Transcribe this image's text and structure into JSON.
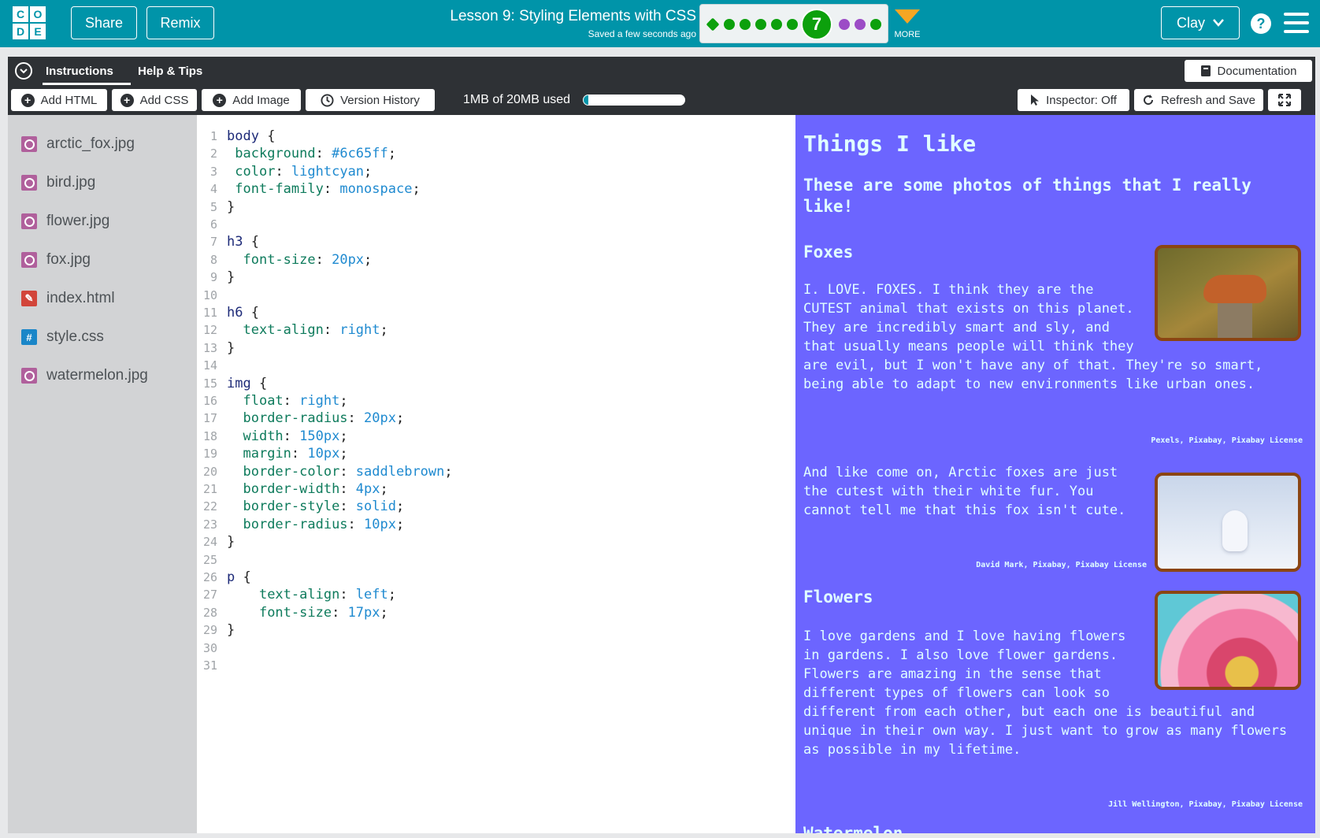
{
  "header": {
    "logo_letters": [
      "C",
      "O",
      "D",
      "E"
    ],
    "share_label": "Share",
    "remix_label": "Remix",
    "lesson_title": "Lesson 9: Styling Elements with CSS",
    "saved_status": "Saved a few seconds ago",
    "current_level": "7",
    "more_label": "MORE",
    "user_name": "Clay",
    "help_glyph": "?"
  },
  "instructions": {
    "tab_instructions": "Instructions",
    "tab_help": "Help & Tips",
    "documentation_label": "Documentation"
  },
  "toolbar": {
    "add_html": "Add HTML",
    "add_css": "Add CSS",
    "add_image": "Add Image",
    "version_history": "Version History",
    "usage_text": "1MB of 20MB used",
    "usage_fraction": 0.05,
    "inspector": "Inspector: Off",
    "refresh_save": "Refresh and Save"
  },
  "files": [
    {
      "name": "arctic_fox.jpg",
      "type": "image"
    },
    {
      "name": "bird.jpg",
      "type": "image"
    },
    {
      "name": "flower.jpg",
      "type": "image"
    },
    {
      "name": "fox.jpg",
      "type": "image"
    },
    {
      "name": "index.html",
      "type": "html"
    },
    {
      "name": "style.css",
      "type": "css"
    },
    {
      "name": "watermelon.jpg",
      "type": "image"
    }
  ],
  "code": [
    "body {",
    " background: #6c65ff;",
    " color: lightcyan;",
    " font-family: monospace;",
    "}",
    "",
    "h3 {",
    "  font-size: 20px;",
    "}",
    "",
    "h6 {",
    "  text-align: right;",
    "}",
    "",
    "img {",
    "  float: right;",
    "  border-radius: 20px;",
    "  width: 150px;",
    "  margin: 10px;",
    "  border-color: saddlebrown;",
    "  border-width: 4px;",
    "  border-style: solid;",
    "  border-radius: 10px;",
    "}",
    "",
    "p {",
    "    text-align: left;",
    "    font-size: 17px;",
    "}",
    "",
    ""
  ],
  "preview": {
    "title": "Things I like",
    "subtitle": "These are some photos of things that I really like!",
    "foxes_heading": "Foxes",
    "foxes_text": "I. LOVE. FOXES. I think they are the CUTEST animal that exists on this planet. They are incredibly smart and sly, and that usually means people will think they are evil, but I won't have any of that. They're so smart, being able to adapt to new environments like urban ones.",
    "foxes_credit": "Pexels, Pixabay, Pixabay License",
    "arctic_text": "And like come on, Arctic foxes are just the cutest with their white fur. You cannot tell me that this fox isn't cute.",
    "arctic_credit": "David Mark, Pixabay, Pixabay License",
    "flowers_heading": "Flowers",
    "flowers_text": "I love gardens and I love having flowers in gardens. I also love flower gardens. Flowers are amazing in the sense that different types of flowers can look so different from each other, but each one is beautiful and unique in their own way. I just want to grow as many flowers as possible in my lifetime.",
    "flowers_credit": "Jill Wellington, Pixabay, Pixabay License",
    "watermelon_heading": "Watermelon"
  },
  "colors": {
    "header_teal": "#0094a9",
    "preview_bg": "#6c65ff",
    "preview_text": "#e0ffff",
    "image_border": "#8b4513",
    "progress_green": "#0ca00c",
    "progress_purple": "#9c4cc6",
    "more_orange": "#f6a623"
  }
}
